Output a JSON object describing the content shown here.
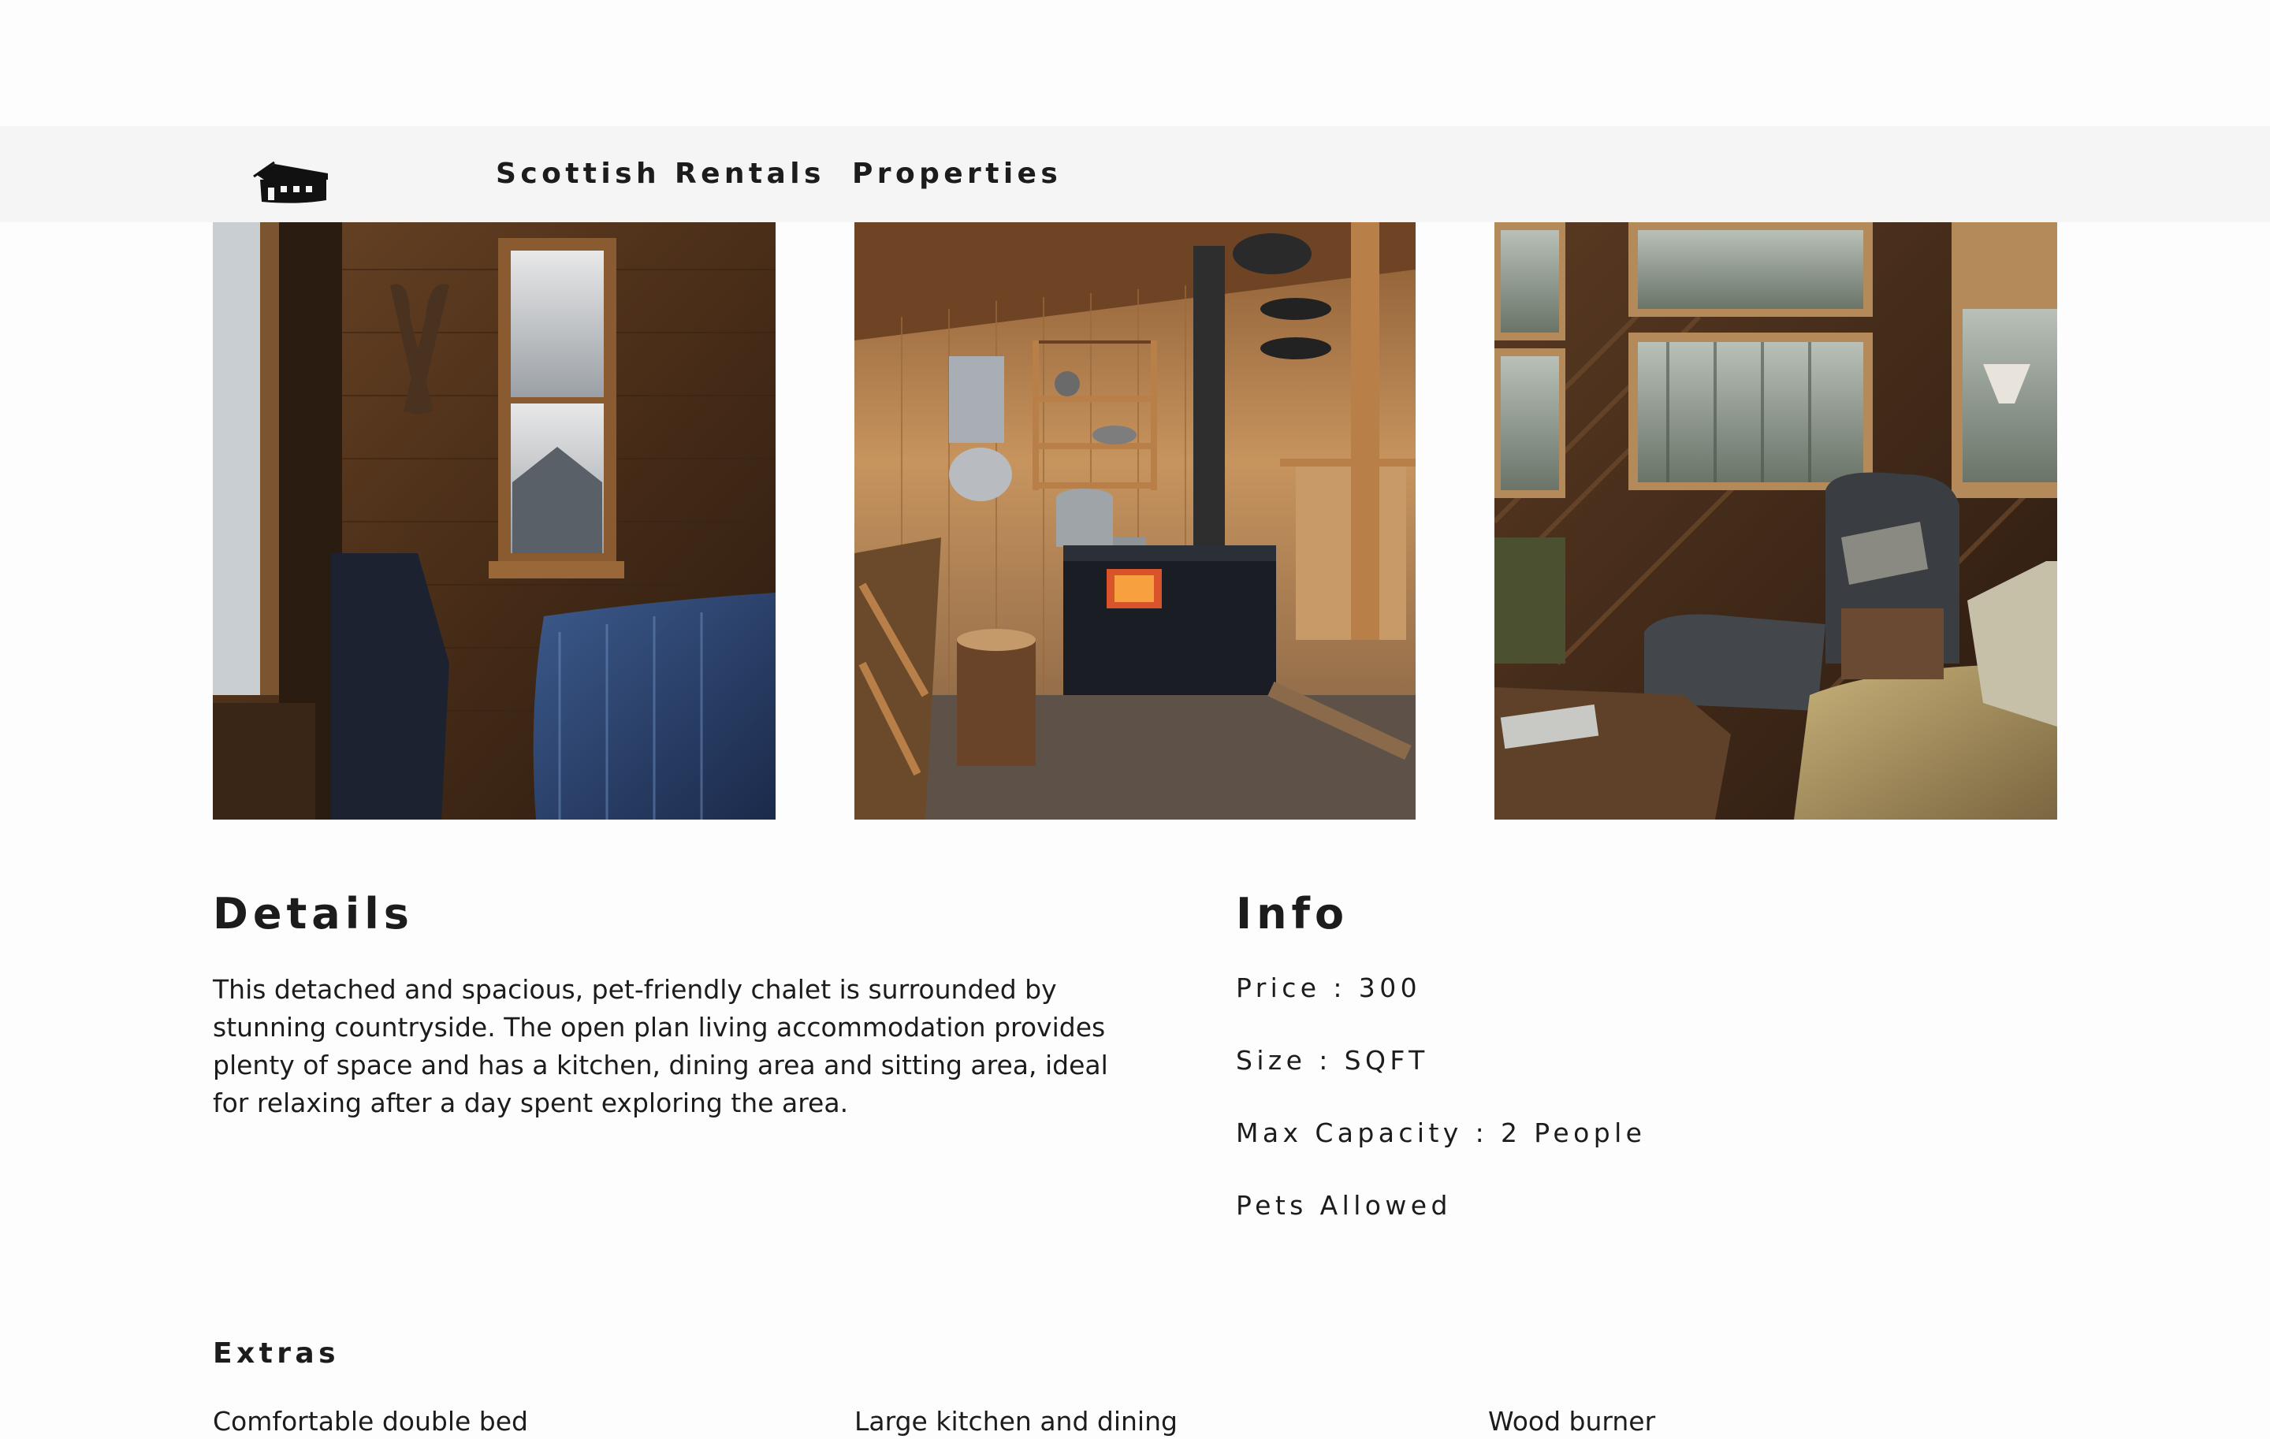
{
  "header": {
    "logo_icon": "chalet-house-icon",
    "brand": "Scottish Rentals",
    "nav_properties": "Properties"
  },
  "gallery": {
    "photos": [
      {
        "subject": "cabin-bedroom-photo"
      },
      {
        "subject": "cabin-wood-stove-kitchen-photo"
      },
      {
        "subject": "cabin-sitting-area-photo"
      }
    ]
  },
  "details": {
    "title": "Details",
    "description": "This detached and spacious, pet-friendly chalet is surrounded by stunning countryside. The open plan living accommodation provides plenty of space and has a kitchen, dining area and sitting area, ideal for relaxing after a day spent exploring the area."
  },
  "info": {
    "title": "Info",
    "price": "Price : 300",
    "size": "Size : SQFT",
    "capacity": "Max Capacity : 2 People",
    "pets": "Pets Allowed"
  },
  "extras": {
    "title": "Extras",
    "items": [
      "Comfortable double bed",
      "Large kitchen and dining",
      "Wood burner"
    ]
  },
  "colors": {
    "navbar_bg": "#f5f5f5",
    "text": "#1c1c1c",
    "page_bg": "#fdfdfd"
  }
}
